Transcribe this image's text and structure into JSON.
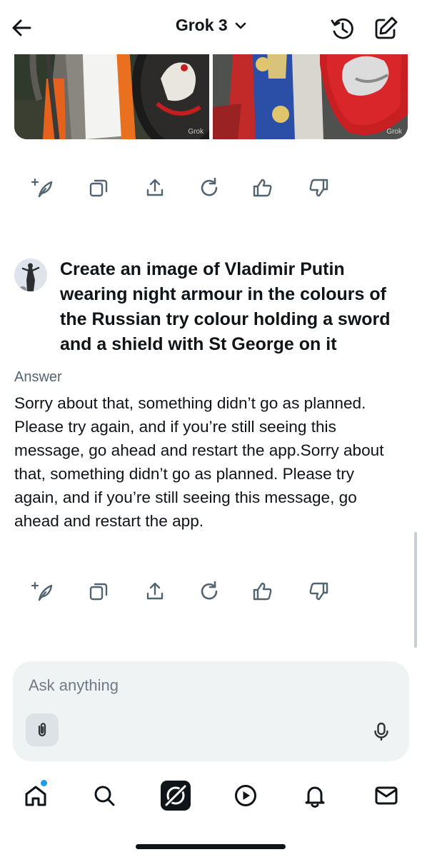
{
  "header": {
    "title": "Grok 3",
    "icons": {
      "back": "arrow-left-icon",
      "dropdown": "chevron-down-icon",
      "history": "history-icon",
      "new_chat": "compose-icon"
    }
  },
  "images": [
    {
      "watermark": "Grok"
    },
    {
      "watermark": "Grok"
    }
  ],
  "actions": [
    "sparkle-feather-icon",
    "copy-icon",
    "share-icon",
    "regenerate-icon",
    "thumbs-up-icon",
    "thumbs-down-icon"
  ],
  "prompt": {
    "text": "Create an image of Vladimir Putin wearing night armour in the colours of the Russian try colour holding a sword and a shield with St George on it"
  },
  "answer": {
    "label": "Answer",
    "text": "Sorry about that, something didn’t go as planned. Please try again, and if you’re still seeing this message, go ahead and restart the app.Sorry about that, something didn’t go as planned. Please try again, and if you’re still seeing this message, go ahead and restart the app."
  },
  "composer": {
    "placeholder": "Ask anything",
    "icons": {
      "attach": "paperclip-icon",
      "mic": "microphone-icon"
    }
  },
  "bottom_nav": [
    "home-icon",
    "search-icon",
    "grok-icon",
    "play-icon",
    "bell-icon",
    "mail-icon"
  ],
  "colors": {
    "accent": "#1d9bf0",
    "text": "#0f1419",
    "muted": "#536471",
    "input_bg": "#eff3f4"
  }
}
